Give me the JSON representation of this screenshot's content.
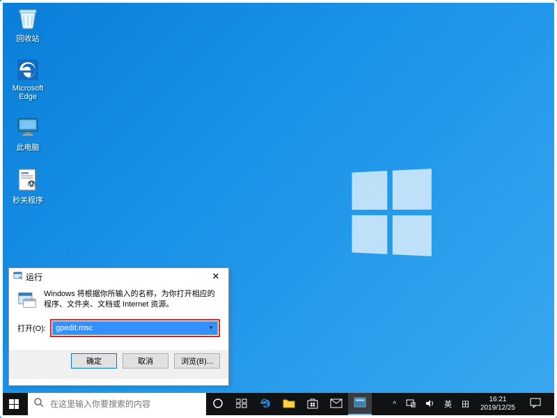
{
  "desktop_icons": {
    "recycle_bin": "回收站",
    "edge": "Microsoft\nEdge",
    "this_pc": "此电脑",
    "shutdown_util": "秒关程序"
  },
  "run_dialog": {
    "title": "运行",
    "description": "Windows 将根据你所输入的名称，为你打开相应的程序、文件夹、文档或 Internet 资源。",
    "open_label": "打开(O):",
    "input_value": "gpedit.msc",
    "buttons": {
      "ok": "确定",
      "cancel": "取消",
      "browse": "浏览(B)..."
    },
    "close": "✕"
  },
  "taskbar": {
    "search_placeholder": "在这里输入你要搜索的内容",
    "tray": {
      "ime_lang": "英",
      "ime_mode": "田",
      "time": "16:21",
      "date": "2019/12/25"
    }
  },
  "colors": {
    "accent": "#0078d7",
    "highlight_red": "#d22"
  }
}
